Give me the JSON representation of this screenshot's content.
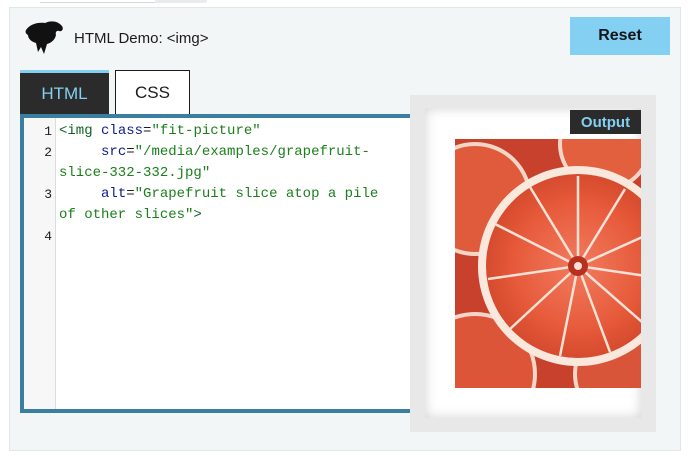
{
  "header": {
    "title": "HTML Demo: <img>",
    "reset_label": "Reset",
    "logo_icon": "mdn-dinosaur-logo-icon"
  },
  "tabs": [
    {
      "label": "HTML",
      "active": true
    },
    {
      "label": "CSS",
      "active": false
    }
  ],
  "editor": {
    "line_numbers": [
      "1",
      "2",
      "3",
      "4"
    ]
  },
  "output": {
    "label": "Output",
    "image_alt": "Grapefruit slice atop a pile of other slices"
  },
  "colors": {
    "accent": "#83d0f2",
    "tab_dark": "#2b2b2b",
    "editor_border": "#3b7fa0"
  }
}
